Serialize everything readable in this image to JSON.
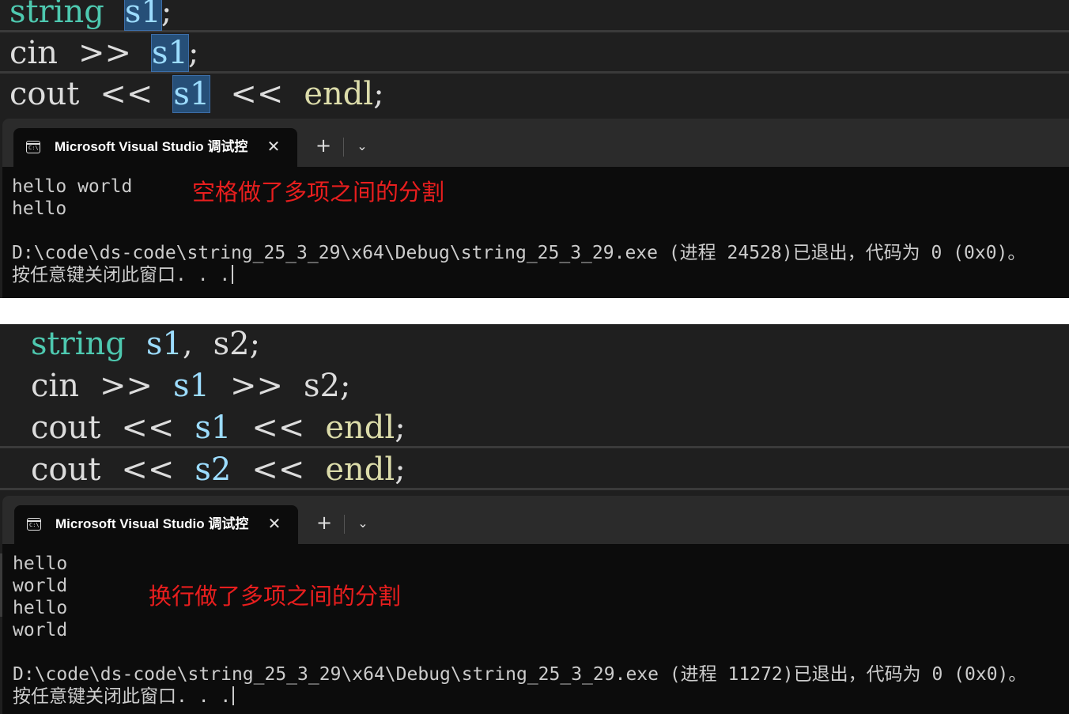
{
  "top": {
    "code": {
      "line1": {
        "type": "string",
        "var": "s1",
        "end": ";"
      },
      "line2": {
        "kw": "cin",
        "op": ">>",
        "var": "s1",
        "end": ";"
      },
      "line3": {
        "kw": "cout",
        "op": "<<",
        "var": "s1",
        "op2": "<<",
        "fn": "endl",
        "end": ";"
      }
    },
    "terminal": {
      "tab_title": "Microsoft Visual Studio 调试控",
      "tab_close": "✕",
      "new_tab": "+",
      "dropdown": "⌄",
      "output_lines": [
        "hello world",
        "hello",
        "",
        "D:\\code\\ds-code\\string_25_3_29\\x64\\Debug\\string_25_3_29.exe (进程 24528)已退出，代码为 0 (0x0)。"
      ],
      "prompt": "按任意键关闭此窗口. . .",
      "annotation": "空格做了多项之间的分割"
    }
  },
  "bottom": {
    "code": {
      "line1": {
        "type": "string",
        "var1": "s1",
        "comma": ",",
        "var2": "s2",
        "end": ";"
      },
      "line2": {
        "kw": "cin",
        "op": ">>",
        "var1": "s1",
        "op2": ">>",
        "var2": "s2",
        "end": ";"
      },
      "line3": {
        "kw": "cout",
        "op": "<<",
        "var": "s1",
        "op2": "<<",
        "fn": "endl",
        "end": ";"
      },
      "line4": {
        "kw": "cout",
        "op": "<<",
        "var": "s2",
        "op2": "<<",
        "fn": "endl",
        "end": ";"
      }
    },
    "terminal": {
      "tab_title": "Microsoft Visual Studio 调试控",
      "tab_close": "✕",
      "new_tab": "+",
      "dropdown": "⌄",
      "output_lines": [
        "hello",
        "world",
        "hello",
        "world",
        "",
        "D:\\code\\ds-code\\string_25_3_29\\x64\\Debug\\string_25_3_29.exe (进程 11272)已退出，代码为 0 (0x0)。"
      ],
      "prompt": "按任意键关闭此窗口. . .",
      "annotation": "换行做了多项之间的分割"
    }
  },
  "colors": {
    "editor_bg": "#1f1f1f",
    "terminal_bg": "#0c0c0c",
    "type_color": "#4ec9b0",
    "variable_color": "#9cdcfe",
    "function_color": "#dcdcaa",
    "annotation_color": "#e81e1e",
    "selection_highlight": "#264f78"
  },
  "icons": {
    "terminal_tab": "terminal-icon",
    "close": "close-icon",
    "new_tab": "plus-icon",
    "dropdown": "chevron-down-icon"
  }
}
